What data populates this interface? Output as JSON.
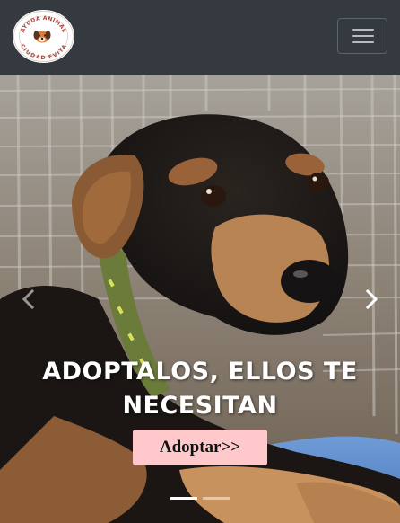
{
  "navbar": {
    "logo": {
      "icon": "dog-face-icon",
      "text_top": "AYUDA ANIMAL",
      "text_bottom": "CIUDAD EVITA"
    },
    "toggler_icon": "hamburger-menu-icon"
  },
  "carousel": {
    "slides": [
      {
        "caption": "ADOPTALOS, ELLOS TE NECESITAN",
        "button_label": "Adoptar>>"
      }
    ],
    "active_index": 0,
    "indicator_count": 2,
    "prev_icon": "chevron-left-icon",
    "next_icon": "chevron-right-icon"
  },
  "colors": {
    "navbar_bg": "#343a40",
    "button_bg": "#ffc9cc",
    "logo_accent": "#b0453c"
  }
}
